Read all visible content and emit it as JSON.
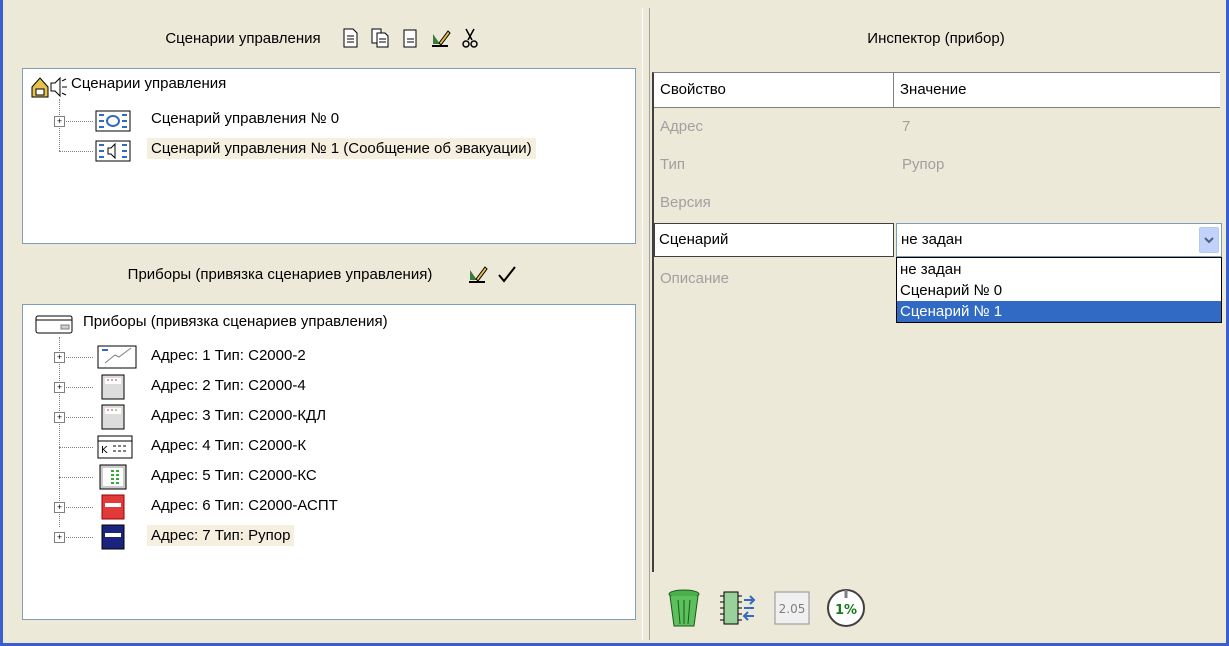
{
  "scenarios_panel": {
    "title": "Сценарии управления",
    "toolbar": [
      "new-doc-icon",
      "copy-doc-icon",
      "doc-icon",
      "edit-icon",
      "cut-icon"
    ],
    "tree": {
      "root": "Сценарии управления",
      "items": [
        {
          "label": "Сценарий управления № 0",
          "expandable": true,
          "selected": false
        },
        {
          "label": "Сценарий управления № 1 (Сообщение об эвакуации)",
          "expandable": false,
          "selected": true
        }
      ]
    }
  },
  "devices_panel": {
    "title": "Приборы  (привязка сценариев управления)",
    "toolbar": [
      "edit-icon",
      "checkmark-icon"
    ],
    "tree": {
      "root": "Приборы (привязка сценариев управления)",
      "items": [
        {
          "label": "Адрес: 1 Тип: С2000-2",
          "expandable": true,
          "icon": "c2000-2-icon"
        },
        {
          "label": "Адрес: 2 Тип: С2000-4",
          "expandable": true,
          "icon": "c2000-4-icon"
        },
        {
          "label": "Адрес: 3 Тип: С2000-КДЛ",
          "expandable": true,
          "icon": "c2000-kdl-icon"
        },
        {
          "label": "Адрес: 4 Тип: С2000-К",
          "expandable": false,
          "icon": "c2000-k-icon"
        },
        {
          "label": "Адрес: 5 Тип: С2000-КС",
          "expandable": false,
          "icon": "c2000-ks-icon"
        },
        {
          "label": "Адрес: 6 Тип: С2000-АСПТ",
          "expandable": true,
          "icon": "c2000-aspt-icon"
        },
        {
          "label": "Адрес: 7 Тип: Рупор",
          "expandable": true,
          "icon": "rupor-icon",
          "selected": true
        }
      ]
    }
  },
  "inspector": {
    "title": "Инспектор (прибор)",
    "col_property": "Свойство",
    "col_value": "Значение",
    "rows": [
      {
        "name": "Адрес",
        "value": "7"
      },
      {
        "name": "Тип",
        "value": "Рупор"
      },
      {
        "name": "Версия",
        "value": ""
      }
    ],
    "active_row": {
      "name": "Сценарий",
      "value": "не задан"
    },
    "description_label": "Описание",
    "dropdown_options": [
      "не задан",
      "Сценарий № 0",
      "Сценарий № 1"
    ],
    "dropdown_highlighted": "Сценарий № 1",
    "bottom_tools": [
      "trash-icon",
      "chip-icon",
      "version-icon",
      "progress-icon"
    ],
    "version_label": "2.05",
    "progress_label": "1%"
  },
  "colors": {
    "window_bg": "#ece9d8",
    "frame_blue": "#3a5fcd",
    "selection_blue": "#316ac5",
    "selected_item_bg": "#f4efdf",
    "disabled_text": "#a0a0a0"
  }
}
